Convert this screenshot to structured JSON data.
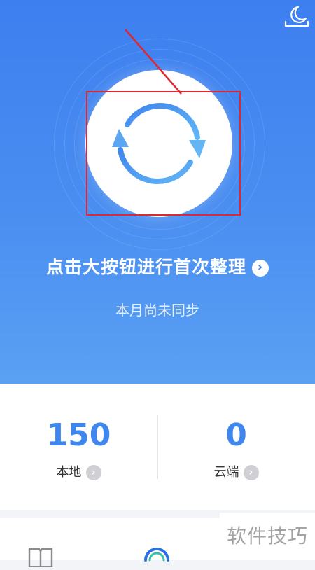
{
  "header": {
    "night_mode_icon": "moon-icon"
  },
  "sync": {
    "icon": "sync-refresh-icon",
    "headline": "点击大按钮进行首次整理",
    "headline_arrow": "›",
    "status": "本月尚未同步"
  },
  "stats": {
    "local": {
      "value": "150",
      "label": "本地",
      "chevron": "›"
    },
    "cloud": {
      "value": "0",
      "label": "云端",
      "chevron": "›"
    }
  },
  "tabbar": {
    "items": [
      {
        "icon": "book-icon"
      },
      {
        "icon": "sync-icon"
      }
    ]
  },
  "watermark": {
    "text": "软件技巧"
  },
  "colors": {
    "accent": "#3f86ef",
    "hero_top": "#3d7fef",
    "hero_bottom": "#5aa1f3",
    "annotation": "#e0262e"
  }
}
